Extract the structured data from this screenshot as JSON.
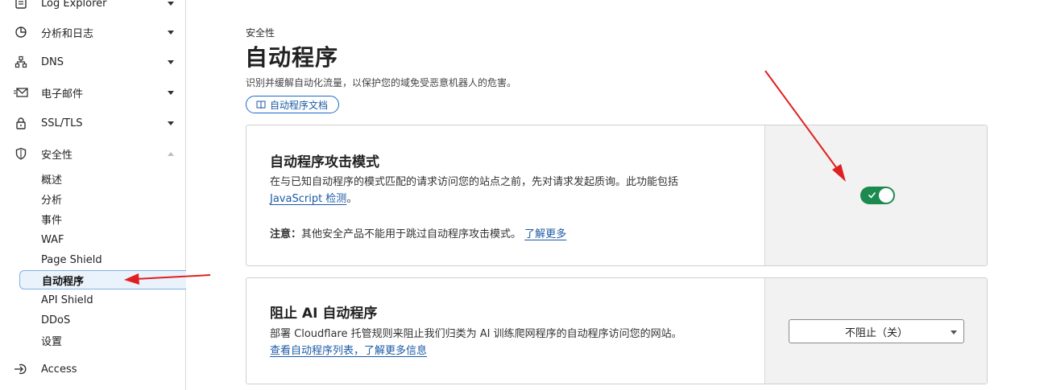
{
  "sidebar": {
    "items": [
      {
        "label": "Log Explorer",
        "icon": "log-icon"
      },
      {
        "label": "分析和日志",
        "icon": "chart-pie-icon"
      },
      {
        "label": "DNS",
        "icon": "network-icon"
      },
      {
        "label": "电子邮件",
        "icon": "mail-icon"
      },
      {
        "label": "SSL/TLS",
        "icon": "lock-icon"
      },
      {
        "label": "安全性",
        "icon": "shield-icon"
      },
      {
        "label": "Access",
        "icon": "login-icon"
      }
    ],
    "security_sub": [
      "概述",
      "分析",
      "事件",
      "WAF",
      "Page Shield",
      "自动程序",
      "API Shield",
      "DDoS",
      "设置"
    ]
  },
  "header": {
    "eyebrow": "安全性",
    "title": "自动程序",
    "description": "识别并缓解自动化流量，以保护您的域免受恶意机器人的危害。",
    "doc_link": "自动程序文档"
  },
  "cards": {
    "bot_fight": {
      "title": "自动程序攻击模式",
      "desc_line1": "在与已知自动程序的模式匹配的请求访问您的站点之前，先对请求发起质询。此功能包括",
      "desc_link": "JavaScript 检测",
      "desc_end": "。",
      "note_label": "注意：",
      "note_text": "其他安全产品不能用于跳过自动程序攻击模式。",
      "note_link": "了解更多",
      "toggle_state": "on"
    },
    "block_ai": {
      "title": "阻止 AI 自动程序",
      "desc_line1": "部署 Cloudflare 托管规则来阻止我们归类为 AI 训练爬网程序的自动程序访问您的网站。",
      "desc_link": "查看自动程序列表，了解更多信息",
      "select_value": "不阻止（关）"
    }
  },
  "colors": {
    "accent": "#1b5aa6",
    "toggle_on": "#1b8a4f",
    "annotation": "#e02020"
  }
}
